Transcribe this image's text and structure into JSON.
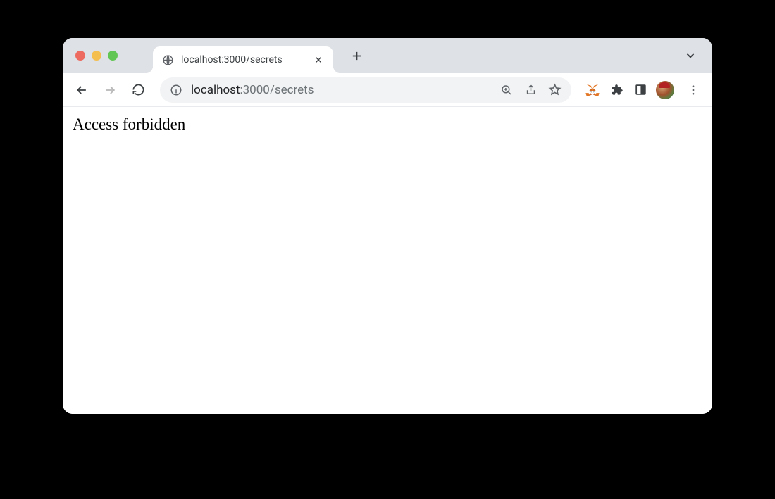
{
  "tab": {
    "title": "localhost:3000/secrets"
  },
  "omnibox": {
    "host": "localhost",
    "path": ":3000/secrets"
  },
  "page": {
    "body_text": "Access forbidden"
  }
}
